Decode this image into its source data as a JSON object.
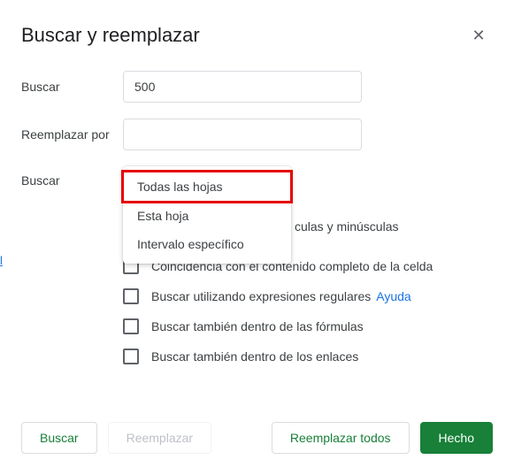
{
  "dialog": {
    "title": "Buscar y reemplazar",
    "close_icon": "✕"
  },
  "fields": {
    "search_label": "Buscar",
    "search_value": "500",
    "replace_label": "Reemplazar por",
    "replace_value": "",
    "scope_label": "Buscar"
  },
  "dropdown": {
    "options": [
      "Todas las hojas",
      "Esta hoja",
      "Intervalo específico"
    ]
  },
  "checkboxes": {
    "match_case_partial": "culas y minúsculas",
    "match_cell": "Coincidencia con el contenido completo de la celda",
    "regex": "Buscar utilizando expresiones regulares",
    "help": "Ayuda",
    "formulas": "Buscar también dentro de las fórmulas",
    "links": "Buscar también dentro de los enlaces"
  },
  "buttons": {
    "search": "Buscar",
    "replace": "Reemplazar",
    "replace_all": "Reemplazar todos",
    "done": "Hecho"
  },
  "link_fragment": "l"
}
